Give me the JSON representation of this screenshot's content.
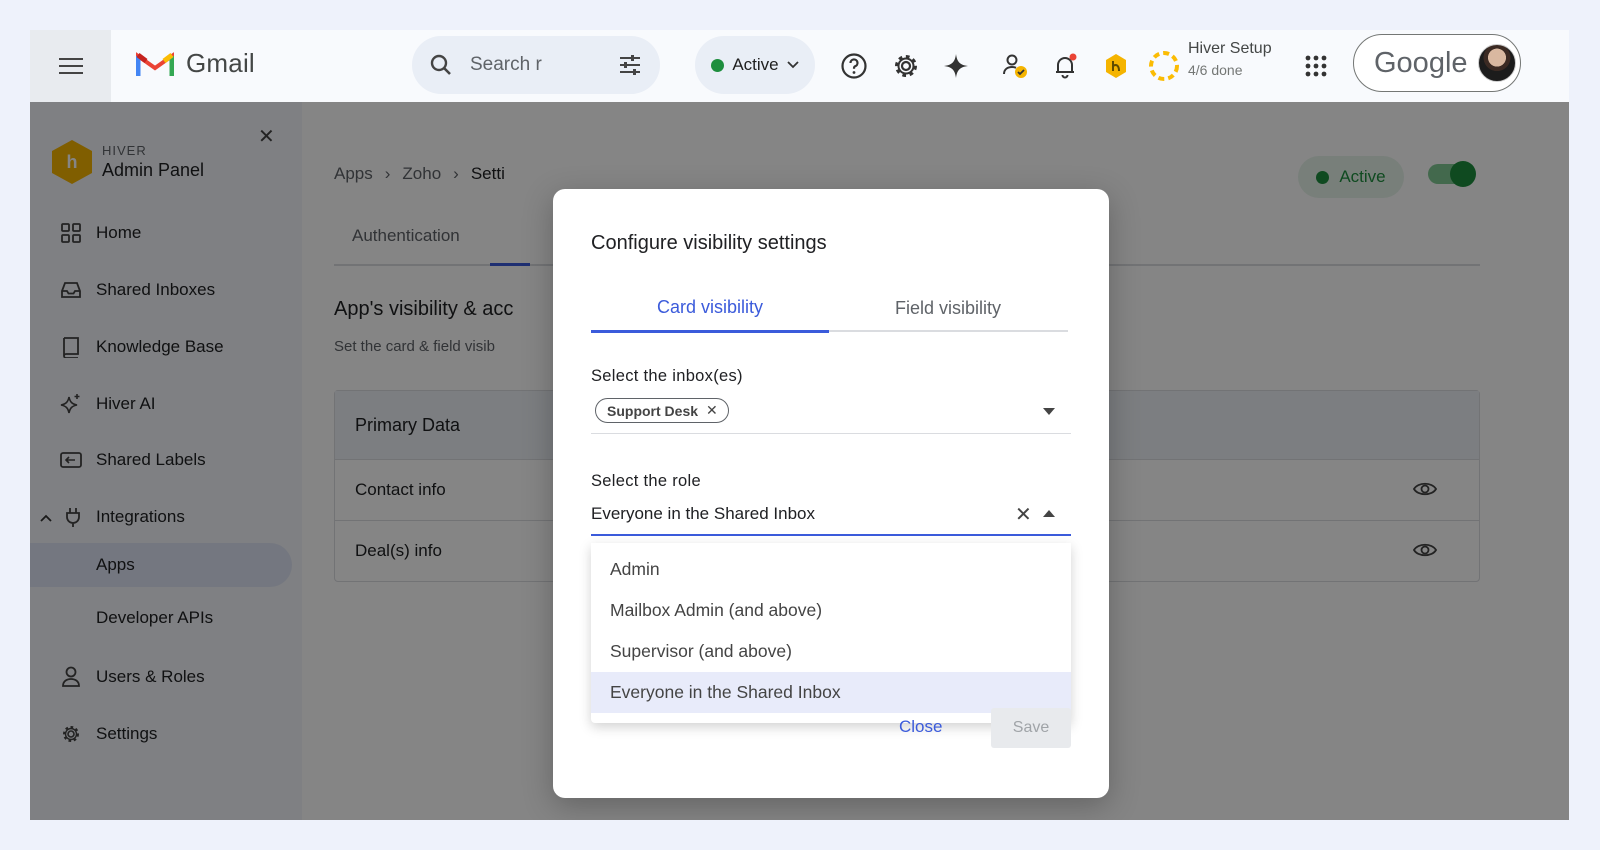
{
  "gmail": {
    "brand": "Gmail",
    "search_text": "Search r",
    "status_label": "Active",
    "setup_title": "Hiver Setup",
    "setup_progress": "4/6 done",
    "account_brand": "Google"
  },
  "sidebar": {
    "brand_small": "HIVER",
    "brand_title": "Admin Panel",
    "items": [
      {
        "label": "Home"
      },
      {
        "label": "Shared Inboxes"
      },
      {
        "label": "Knowledge Base"
      },
      {
        "label": "Hiver AI"
      },
      {
        "label": "Shared Labels"
      },
      {
        "label": "Integrations"
      },
      {
        "label": "Apps"
      },
      {
        "label": "Developer APIs"
      },
      {
        "label": "Users & Roles"
      },
      {
        "label": "Settings"
      }
    ]
  },
  "page": {
    "breadcrumbs": [
      "Apps",
      "Zoho",
      "Setti"
    ],
    "status_chip": "Active",
    "tab_authentication": "Authentication",
    "section_title": "App's visibility & acc",
    "section_subtitle": "Set the card & field visib",
    "table_header": "Primary Data",
    "rows": [
      {
        "label": "Contact info"
      },
      {
        "label": "Deal(s) info"
      }
    ]
  },
  "modal": {
    "title": "Configure visibility settings",
    "tab_card": "Card visibility",
    "tab_field": "Field visibility",
    "inbox_label": "Select the inbox(es)",
    "inbox_chip": "Support Desk",
    "role_label": "Select the role",
    "role_value": "Everyone in the Shared Inbox",
    "options": [
      {
        "label": "Admin"
      },
      {
        "label": "Mailbox Admin (and above)"
      },
      {
        "label": "Supervisor (and above)"
      },
      {
        "label": "Everyone in the Shared Inbox"
      }
    ],
    "close_label": "Close",
    "save_label": "Save"
  },
  "colors": {
    "accent": "#3b5bdb",
    "active_green": "#1e8e3e",
    "hiver_yellow": "#f5b400"
  }
}
